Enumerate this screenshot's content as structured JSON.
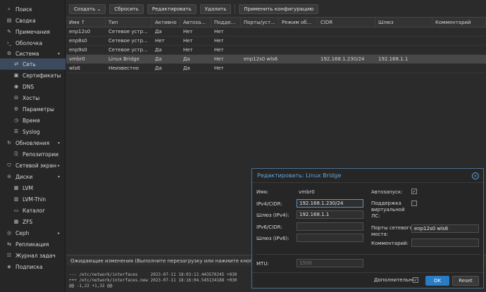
{
  "sidebar": {
    "items": [
      {
        "label": "Поиск",
        "icon": "search-icon",
        "glyph": "⌕"
      },
      {
        "label": "Сводка",
        "icon": "summary-icon",
        "glyph": "▤"
      },
      {
        "label": "Примечания",
        "icon": "notes-icon",
        "glyph": "✎"
      },
      {
        "label": "Оболочка",
        "icon": "terminal-icon",
        "glyph": "›_"
      },
      {
        "label": "Система",
        "icon": "gear-icon",
        "glyph": "⚙"
      },
      {
        "label": "Сеть",
        "icon": "network-icon",
        "glyph": "⇄"
      },
      {
        "label": "Сертификаты",
        "icon": "certificate-icon",
        "glyph": "▣"
      },
      {
        "label": "DNS",
        "icon": "globe-icon",
        "glyph": "◉"
      },
      {
        "label": "Хосты",
        "icon": "hosts-icon",
        "glyph": "⊟"
      },
      {
        "label": "Параметры",
        "icon": "options-icon",
        "glyph": "⚙"
      },
      {
        "label": "Время",
        "icon": "clock-icon",
        "glyph": "◷"
      },
      {
        "label": "Syslog",
        "icon": "log-icon",
        "glyph": "☰"
      },
      {
        "label": "Обновления",
        "icon": "refresh-icon",
        "glyph": "↻"
      },
      {
        "label": "Репозитории",
        "icon": "repository-icon",
        "glyph": "⎘"
      },
      {
        "label": "Сетевой экран",
        "icon": "shield-icon",
        "glyph": "⛉"
      },
      {
        "label": "Диски",
        "icon": "disk-icon",
        "glyph": "⊖"
      },
      {
        "label": "LVM",
        "icon": "lvm-icon",
        "glyph": "▦"
      },
      {
        "label": "LVM-Thin",
        "icon": "lvm-thin-icon",
        "glyph": "▥"
      },
      {
        "label": "Каталог",
        "icon": "folder-icon",
        "glyph": "▭"
      },
      {
        "label": "ZFS",
        "icon": "zfs-icon",
        "glyph": "▦"
      },
      {
        "label": "Ceph",
        "icon": "ceph-icon",
        "glyph": "◎"
      },
      {
        "label": "Репликация",
        "icon": "replication-icon",
        "glyph": "⇆"
      },
      {
        "label": "Журнал задач",
        "icon": "task-log-icon",
        "glyph": "☷"
      },
      {
        "label": "Подписка",
        "icon": "subscription-icon",
        "glyph": "◈"
      }
    ]
  },
  "toolbar": {
    "create_label": "Создать ⌄",
    "revert_label": "Сбросить",
    "edit_label": "Редактировать",
    "delete_label": "Удалить",
    "apply_label": "Применить конфигурацию"
  },
  "grid": {
    "columns": [
      "Имя ↑",
      "Тип",
      "Активно",
      "Автоза...",
      "Подде...",
      "Порты/уст...",
      "Режим об...",
      "CIDR",
      "Шлюз",
      "Комментарий"
    ],
    "rows": [
      [
        "enp12s0",
        "Сетевое устр...",
        "Да",
        "Нет",
        "Нет",
        "",
        "",
        "",
        "",
        ""
      ],
      [
        "enp8s0",
        "Сетевое устр...",
        "Нет",
        "Нет",
        "Нет",
        "",
        "",
        "",
        "",
        ""
      ],
      [
        "enp9s0",
        "Сетевое устр...",
        "Да",
        "Нет",
        "Нет",
        "",
        "",
        "",
        "",
        ""
      ],
      [
        "vmbr0",
        "Linux Bridge",
        "Да",
        "Да",
        "Нет",
        "enp12s0 wls6",
        "",
        "192.168.1.230/24",
        "192.168.1.1",
        ""
      ],
      [
        "wls6",
        "Неизвестно",
        "Да",
        "Да",
        "Нет",
        "",
        "",
        "",
        "",
        ""
      ]
    ]
  },
  "pending": {
    "text": "Ожидающие изменения (Выполните перезагрузку или нажмите кнопку «При",
    "diff": "--- /etc/network/interfaces     2023-07-11 18:03:12.443570245 +030\n+++ /etc/network/interfaces.new 2023-07-11 18:16:04.545134188 +030\n@@ -1,22 +1,32 @@"
  },
  "dialog": {
    "title": "Редактировать: Linux Bridge",
    "name_label": "Имя:",
    "name_value": "vmbr0",
    "ipv4_label": "IPv4/CIDR:",
    "ipv4_value": "192.168.1.230/24",
    "gw4_label": "Шлюз (IPv4):",
    "gw4_value": "192.168.1.1",
    "ipv6_label": "IPv6/CIDR:",
    "ipv6_value": "",
    "gw6_label": "Шлюз (IPv6):",
    "gw6_value": "",
    "autostart_label": "Автозапуск:",
    "autostart_checked": true,
    "vlan_label_1": "Поддержка",
    "vlan_label_2": "виртуальной",
    "vlan_label_3": "ЛС:",
    "vlan_checked": false,
    "ports_label_1": "Порты сетевого",
    "ports_label_2": "моста:",
    "ports_value": "enp12s0 wls6",
    "comment_label": "Комментарий:",
    "comment_value": "",
    "mtu_label": "MTU:",
    "mtu_placeholder": "1500",
    "advanced_label": "Дополнительно",
    "advanced_checked": true,
    "ok_label": "OK",
    "reset_label": "Reset"
  },
  "colors": {
    "accent": "#2a7cc7",
    "title_blue": "#63a8e0",
    "selected_nav": "#3b4a5c"
  }
}
